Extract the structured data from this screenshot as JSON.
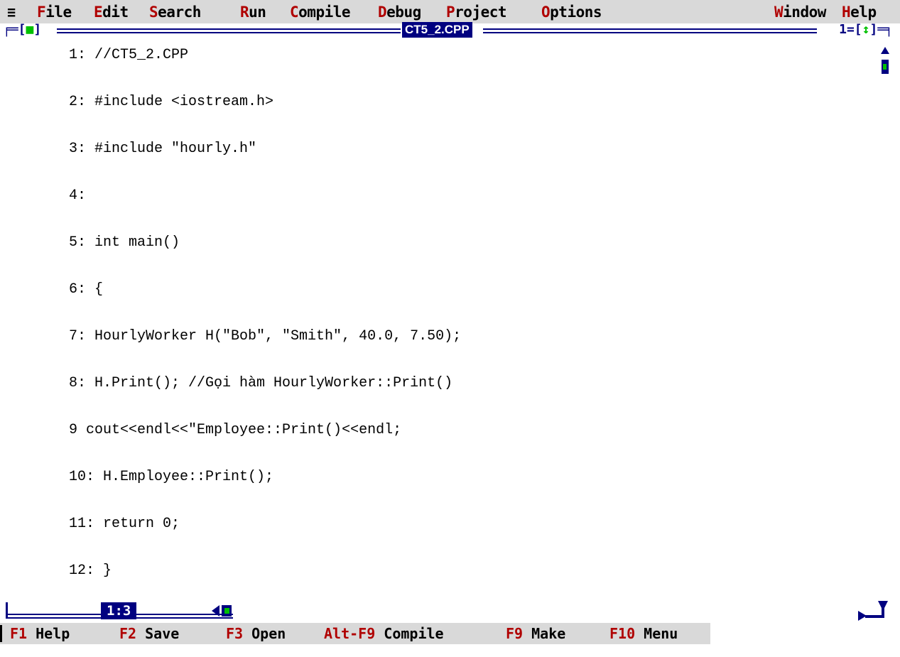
{
  "menubar": {
    "system_icon": "≡",
    "items": [
      {
        "hot": "F",
        "rest": "ile"
      },
      {
        "hot": "E",
        "rest": "dit"
      },
      {
        "hot": "S",
        "rest": "earch"
      },
      {
        "hot": "R",
        "rest": "un"
      },
      {
        "hot": "C",
        "rest": "ompile"
      },
      {
        "hot": "D",
        "rest": "ebug"
      },
      {
        "hot": "P",
        "rest": "roject"
      },
      {
        "hot": "O",
        "rest": "ptions"
      },
      {
        "hot": "W",
        "rest": "indow"
      },
      {
        "hot": "H",
        "rest": "elp"
      }
    ]
  },
  "window": {
    "title": "CT5_2.CPP",
    "close_box": {
      "left": "╒═[",
      "mark": "■",
      "right": "]"
    },
    "number_box": {
      "left": "1=[",
      "mark": "↕",
      "right": "]═╕"
    },
    "cursor_position": "1:3"
  },
  "code_lines": [
    "1: //CT5_2.CPP",
    "2: #include <iostream.h>",
    "3: #include \"hourly.h\"",
    "4:",
    "5: int main()",
    "6: {",
    "7: HourlyWorker H(\"Bob\", \"Smith\", 40.0, 7.50);",
    "8: H.Print(); //Gọi hàm HourlyWorker::Print()",
    "9 cout<<endl<<\"Employee::Print()<<endl;",
    "10: H.Employee::Print();",
    "11: return 0;",
    "12: }"
  ],
  "statusbar": {
    "items": [
      {
        "key": "F1",
        "label": "Help"
      },
      {
        "key": "F2",
        "label": "Save"
      },
      {
        "key": "F3",
        "label": "Open"
      },
      {
        "key": "Alt-F9",
        "label": "Compile"
      },
      {
        "key": "F9",
        "label": "Make"
      },
      {
        "key": "F10",
        "label": "Menu"
      }
    ]
  },
  "colors": {
    "menu_bg": "#d9d9d9",
    "hotkey": "#b00000",
    "frame": "#000080",
    "accent_green": "#00c000"
  },
  "icons": {
    "scroll_up": "scroll-up-arrow-icon",
    "scroll_down": "scroll-down-arrow-icon",
    "scroll_left": "scroll-left-arrow-icon",
    "resize": "resize-corner-icon"
  }
}
